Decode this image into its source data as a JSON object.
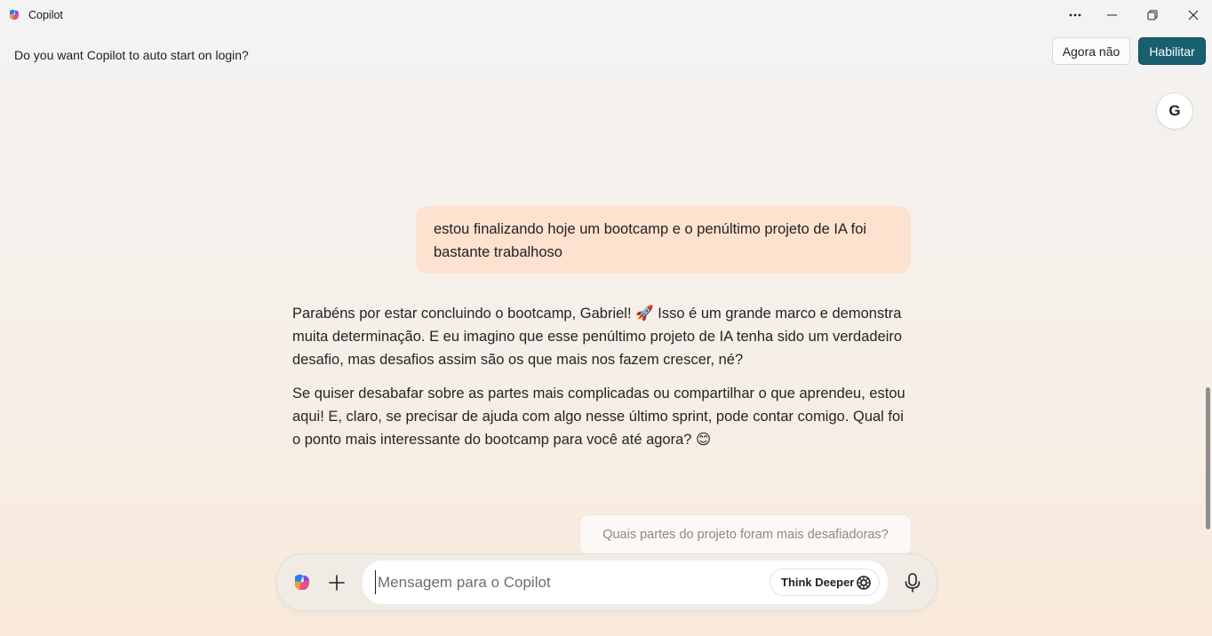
{
  "titlebar": {
    "app_title": "Copilot",
    "icons": [
      "copilot-logo-icon",
      "more-icon",
      "minimize-icon",
      "restore-icon",
      "close-icon"
    ]
  },
  "notification": {
    "text": "Do you want Copilot to auto start on login?",
    "secondary_label": "Agora não",
    "primary_label": "Habilitar",
    "primary_color": "#185f70"
  },
  "user": {
    "avatar_initial": "G"
  },
  "conversation": {
    "user_message": "estou finalizando hoje um bootcamp e o penúltimo projeto de IA foi bastante trabalhoso",
    "assistant_paragraphs": [
      "Parabéns por estar concluindo o bootcamp, Gabriel! 🚀 Isso é um grande marco e demonstra muita determinação. E eu imagino que esse penúltimo projeto de IA tenha sido um verdadeiro desafio, mas desafios assim são os que mais nos fazem crescer, né?",
      "Se quiser desabafar sobre as partes mais complicadas ou compartilhar o que aprendeu, estou aqui! E, claro, se precisar de ajuda com algo nesse último sprint, pode contar comigo. Qual foi o ponto mais interessante do bootcamp para você até agora? 😊"
    ],
    "user_bubble_color": "#fce2cf"
  },
  "suggestion": {
    "label": "Quais partes do projeto foram mais desafiadoras?"
  },
  "composer": {
    "placeholder": "Mensagem para o Copilot",
    "value": "",
    "think_label": "Think Deeper",
    "icons": [
      "copilot-logo-icon",
      "plus-icon",
      "think-deeper-icon",
      "microphone-icon"
    ]
  }
}
